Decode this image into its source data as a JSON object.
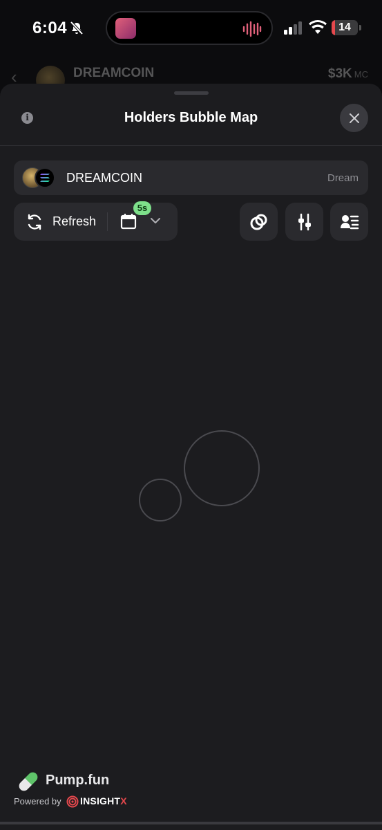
{
  "status_bar": {
    "time": "6:04",
    "battery_level": "14",
    "battery_fraction": 0.14,
    "battery_color": "#e5484d"
  },
  "background_app": {
    "token_name": "DREAMCOIN",
    "market_cap": "$3K",
    "market_cap_unit": "MC"
  },
  "sheet": {
    "title": "Holders Bubble Map"
  },
  "token": {
    "name": "DREAMCOIN",
    "symbol": "Dream"
  },
  "toolbar": {
    "refresh_label": "Refresh",
    "interval_badge": "5s",
    "accent": "#7ee08b"
  },
  "icons": [
    "info-icon",
    "close-icon",
    "refresh-icon",
    "calendar-icon",
    "chevron-down-icon",
    "link-rings-icon",
    "sliders-icon",
    "holder-list-icon"
  ],
  "branding": {
    "name": "Pump.fun",
    "powered_by": "Powered by",
    "partner_main": "INSIGHT",
    "partner_suffix": "X"
  }
}
